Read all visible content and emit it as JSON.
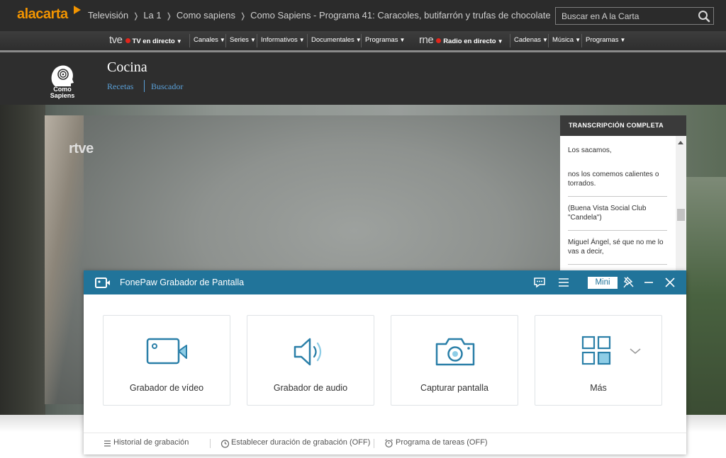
{
  "topbar": {
    "logo": "alacarta",
    "breadcrumbs": [
      "Televisión",
      "La 1",
      "Como sapiens",
      "Como Sapiens - Programa 41: Caracoles, butifarrón y trufas de chocolate"
    ],
    "search_placeholder": "Buscar en A la Carta",
    "accent_color": "#f29400"
  },
  "nav": {
    "tve_brand": "tve",
    "tve_live": "TV en directo",
    "tve_items": [
      "Canales",
      "Series",
      "Informativos",
      "Documentales",
      "Programas"
    ],
    "rne_brand": "rne",
    "rne_live": "Radio en directo",
    "rne_items": [
      "Cadenas",
      "Música",
      "Programas"
    ]
  },
  "section": {
    "logo_text": "Como Sapiens",
    "title": "Cocina",
    "links": [
      "Recetas",
      "Buscador"
    ],
    "link_color": "#5aa0d8"
  },
  "video": {
    "watermark": "rtve"
  },
  "transcript": {
    "heading": "TRANSCRIPCIÓN COMPLETA",
    "lines": [
      "Los sacamos,",
      "nos los comemos calientes o torrados.",
      "(Buena Vista Social Club \"Candela\")",
      "Miguel Ángel, sé que no me lo vas a decir,"
    ]
  },
  "fonepaw": {
    "title": "FonePaw Grabador de Pantalla",
    "mini_label": "Mini",
    "title_color": "#21749a",
    "cards": [
      {
        "label": "Grabador de vídeo",
        "icon": "video-camera-icon"
      },
      {
        "label": "Grabador de audio",
        "icon": "speaker-icon"
      },
      {
        "label": "Capturar pantalla",
        "icon": "camera-icon"
      },
      {
        "label": "Más",
        "icon": "grid-icon"
      }
    ],
    "footer": {
      "history": "Historial de grabación",
      "duration": "Establecer duración de grabación (OFF)",
      "schedule": "Programa de tareas (OFF)"
    }
  }
}
